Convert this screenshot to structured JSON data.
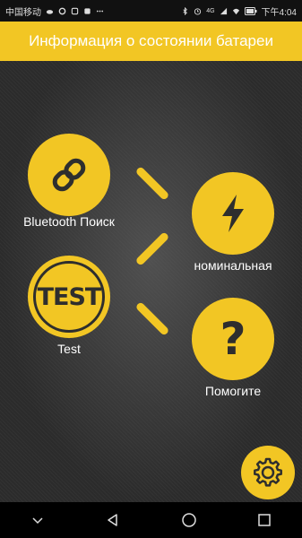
{
  "status_bar": {
    "carrier": "中国移动",
    "time": "下午4:04",
    "network": "4G"
  },
  "app_bar": {
    "title": "Информация о состоянии батареи"
  },
  "buttons": {
    "bluetooth": {
      "label": "Bluetooth Поиск",
      "icon": "link-icon"
    },
    "test": {
      "label": "Test",
      "badge_text": "TEST"
    },
    "nominal": {
      "label": "номинальная",
      "icon": "lightning-icon"
    },
    "help": {
      "label": "Помогите",
      "icon": "question-icon"
    },
    "settings": {
      "icon": "gear-icon"
    }
  },
  "colors": {
    "accent": "#f2c624",
    "background": "#2b2b2b",
    "icon_dark": "#2e2e2e"
  }
}
